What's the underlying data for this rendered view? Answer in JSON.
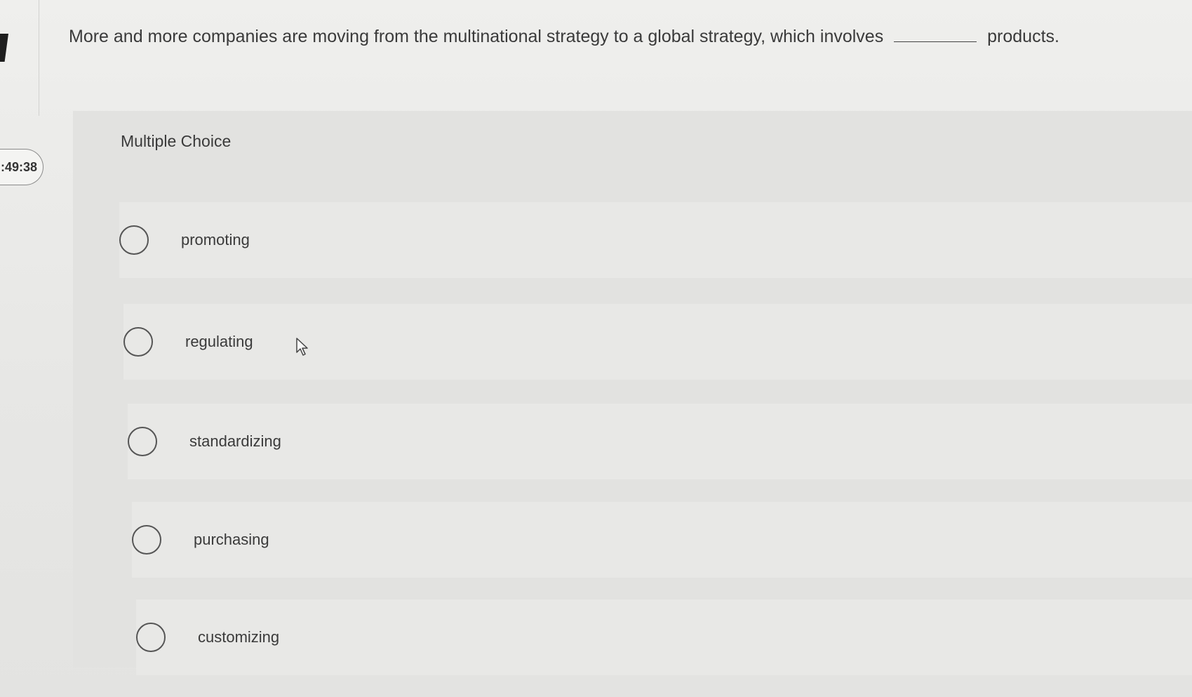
{
  "question": {
    "text_before": "More and more companies are moving from the multinational strategy to a global strategy, which involves",
    "text_after": "products."
  },
  "timer": {
    "value": ":49:38"
  },
  "panel": {
    "title": "Multiple Choice"
  },
  "choices": [
    {
      "label": "promoting",
      "selected": false
    },
    {
      "label": "regulating",
      "selected": false
    },
    {
      "label": "standardizing",
      "selected": false
    },
    {
      "label": "purchasing",
      "selected": false
    },
    {
      "label": "customizing",
      "selected": false
    }
  ],
  "icons": {
    "radio": "radio-unselected-icon",
    "cursor": "mouse-pointer-icon"
  }
}
